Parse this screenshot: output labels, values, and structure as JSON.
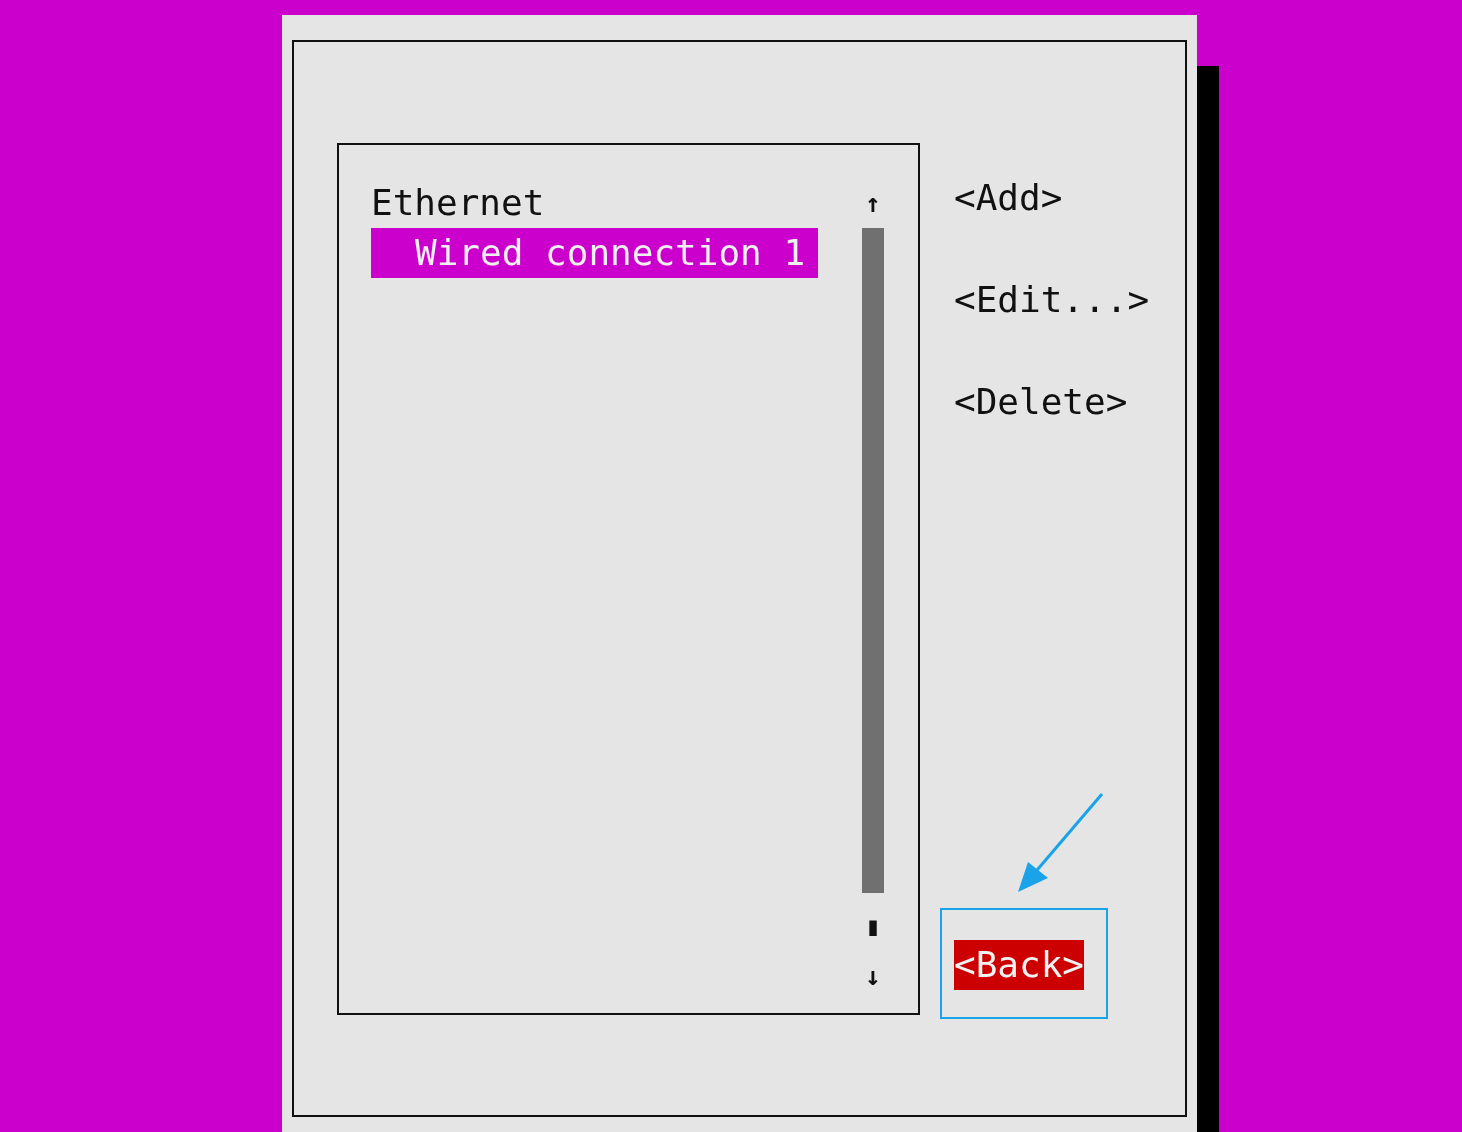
{
  "list": {
    "items": [
      {
        "label": "Ethernet",
        "kind": "header",
        "selected": false
      },
      {
        "label": "Wired connection 1",
        "kind": "entry",
        "selected": true
      }
    ],
    "scroll_up": "↑",
    "scroll_thumb": "▮",
    "scroll_down": "↓"
  },
  "buttons": [
    {
      "label": "<Add>",
      "selected": false
    },
    {
      "label": "<Edit...>",
      "selected": false
    },
    {
      "label": "<Delete>",
      "selected": false
    },
    {
      "label": "<Back>",
      "selected": true
    }
  ]
}
